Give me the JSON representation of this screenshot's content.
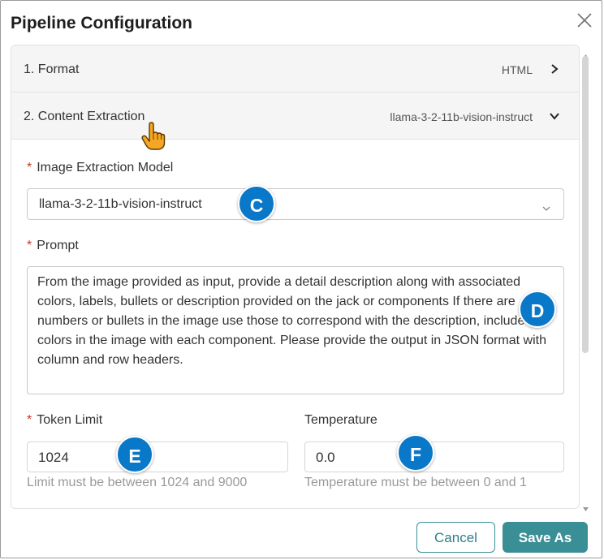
{
  "dialog": {
    "title": "Pipeline Configuration",
    "close_icon": "close-icon"
  },
  "steps": [
    {
      "label": "1. Format",
      "value": "HTML",
      "icon": "chevron-right-icon"
    },
    {
      "label": "2. Content Extraction",
      "value": "llama-3-2-11b-vision-instruct",
      "icon": "chevron-down-icon"
    }
  ],
  "fields": {
    "image_model": {
      "required_mark": "*",
      "label": "Image Extraction Model",
      "value": "llama-3-2-11b-vision-instruct"
    },
    "prompt": {
      "required_mark": "*",
      "label": "Prompt",
      "value": "From the image provided as input, provide a detail description along with associated colors, labels, bullets or description provided on the jack or components If there are numbers or bullets in the image use those to correspond with the description, include the colors in the image with each component. Please provide the output in JSON format with column and row headers."
    },
    "token_limit": {
      "required_mark": "*",
      "label": "Token Limit",
      "value": "1024",
      "hint": "Limit must be between 1024 and 9000"
    },
    "temperature": {
      "label": "Temperature",
      "value": "0.0",
      "hint": "Temperature must be between 0 and 1"
    }
  },
  "callouts": {
    "c": "C",
    "d": "D",
    "e": "E",
    "f": "F"
  },
  "buttons": {
    "cancel": "Cancel",
    "save_as": "Save As"
  },
  "colors": {
    "accent": "#3a8f96",
    "callout": "#0a78c9",
    "required": "#c0392b"
  }
}
